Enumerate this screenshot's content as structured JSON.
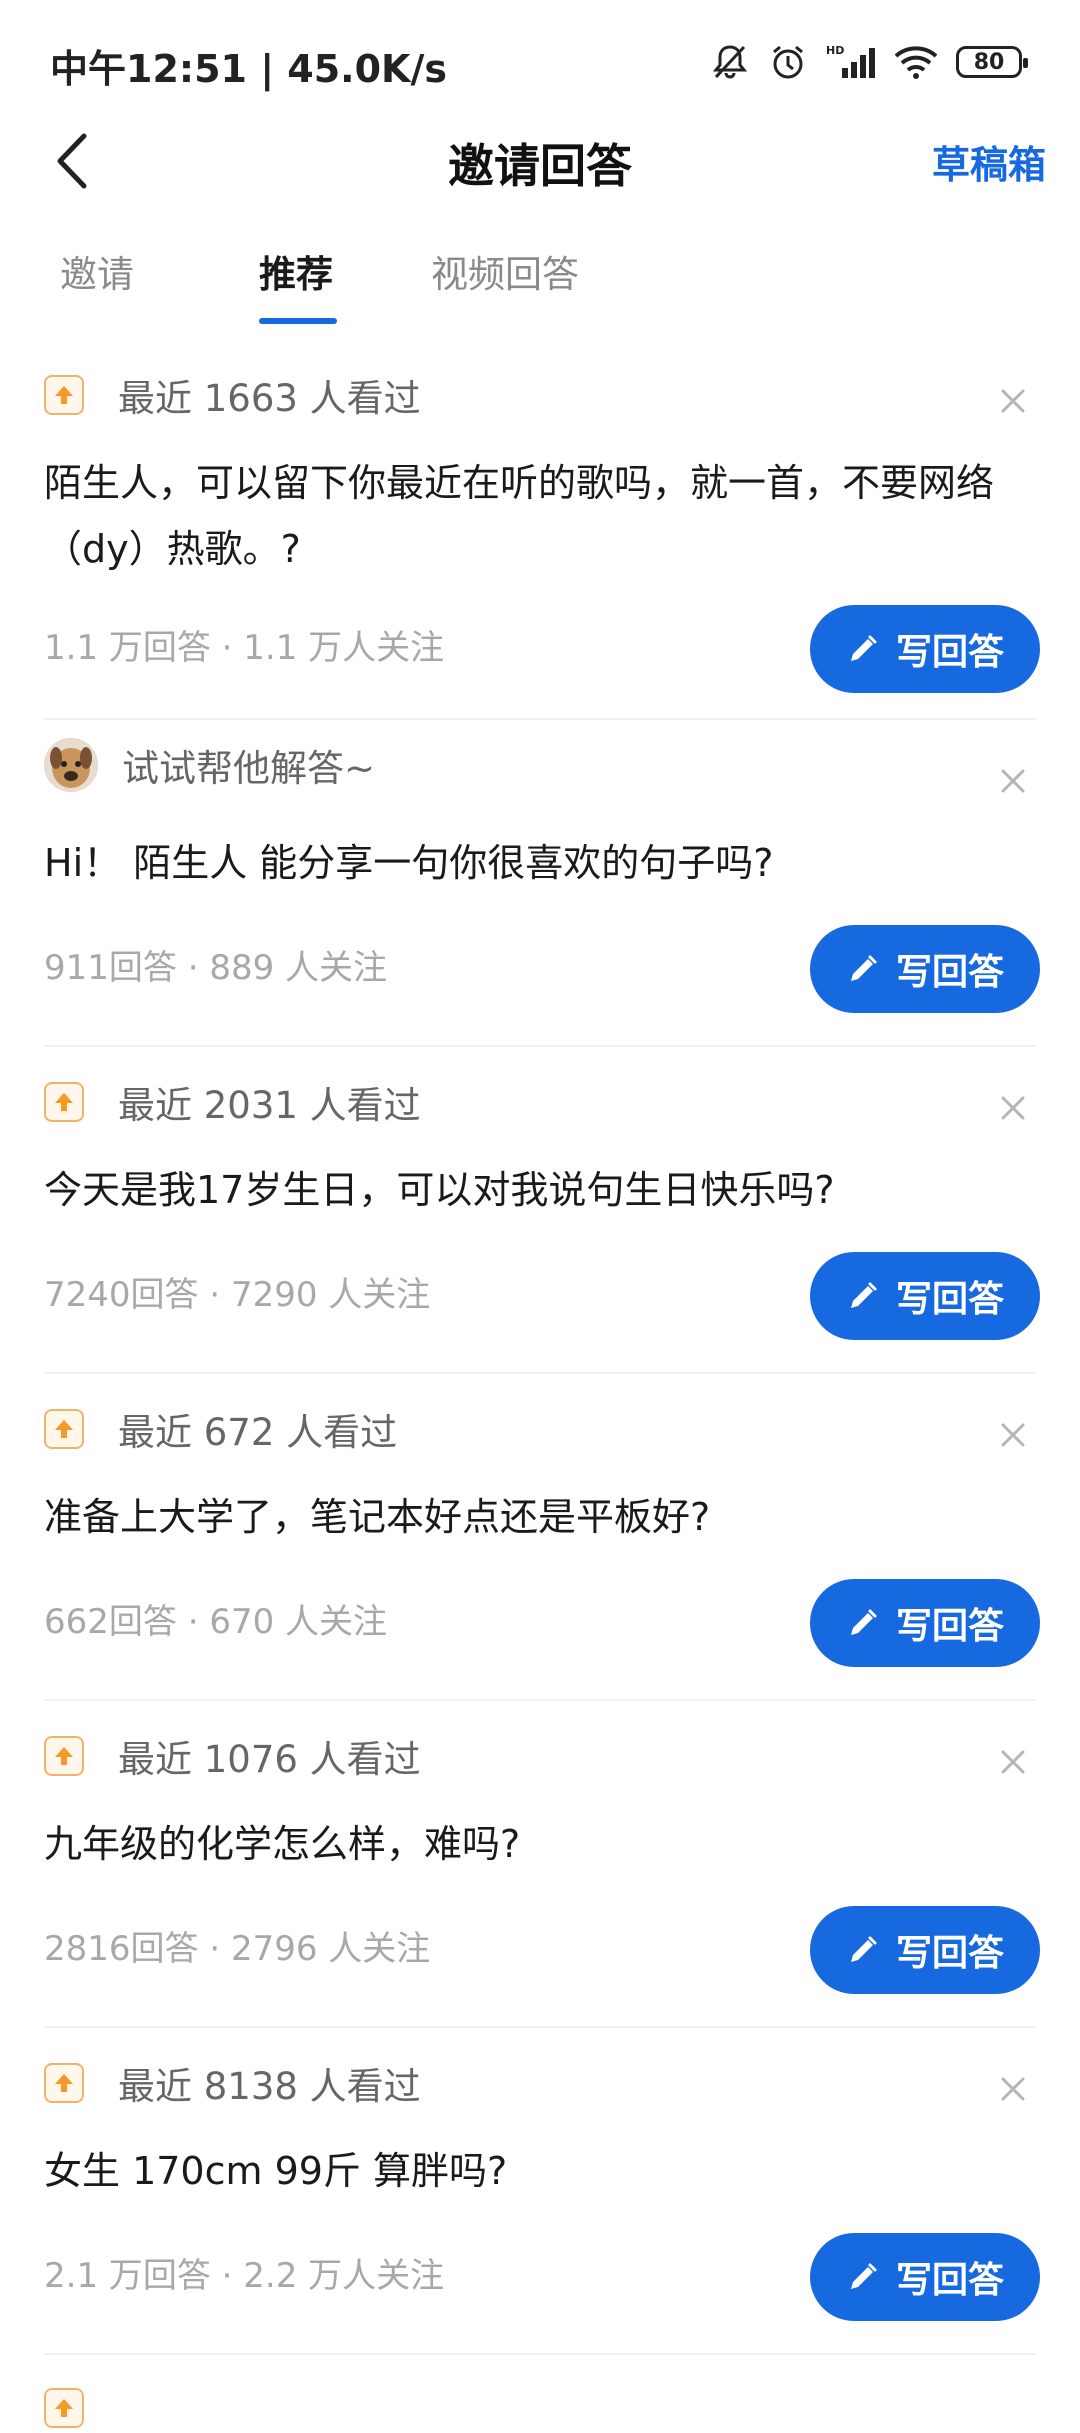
{
  "status_bar": {
    "text": "中午12:51 | 45.0K/s",
    "battery": "80",
    "icons": [
      "bell-muted-icon",
      "alarm-icon",
      "hd-signal-icon",
      "wifi-icon",
      "battery-icon"
    ]
  },
  "header": {
    "title": "邀请回答",
    "right_label": "草稿箱",
    "back_icon": "back-arrow-icon"
  },
  "tabs": [
    {
      "label": "邀请",
      "active": false
    },
    {
      "label": "推荐",
      "active": true
    },
    {
      "label": "视频回答",
      "active": false
    }
  ],
  "colors": {
    "accent": "#1769e0",
    "meta_text": "#666666",
    "stats_text": "#a8a8a8",
    "badge_border": "#f0b36a",
    "badge_arrow": "#f59a23"
  },
  "button_label": "写回答",
  "cards": [
    {
      "meta_icon": "trending-up-icon",
      "meta": "最近 1663 人看过",
      "question": "陌生人，可以留下你最近在听的歌吗，就一首，不要网络（dy）热歌。?",
      "stats": "1.1 万回答 · 1.1 万人关注"
    },
    {
      "meta_icon": "avatar-icon",
      "meta": "试试帮他解答~",
      "question": "Hi！ 陌生人 能分享一句你很喜欢的句子吗?",
      "stats": "911回答 · 889 人关注"
    },
    {
      "meta_icon": "trending-up-icon",
      "meta": "最近 2031 人看过",
      "question": "今天是我17岁生日，可以对我说句生日快乐吗?",
      "stats": "7240回答 · 7290 人关注"
    },
    {
      "meta_icon": "trending-up-icon",
      "meta": "最近 672 人看过",
      "question": "准备上大学了，笔记本好点还是平板好?",
      "stats": "662回答 · 670 人关注"
    },
    {
      "meta_icon": "trending-up-icon",
      "meta": "最近 1076 人看过",
      "question": "九年级的化学怎么样，难吗?",
      "stats": "2816回答 · 2796 人关注"
    },
    {
      "meta_icon": "trending-up-icon",
      "meta": "最近 8138 人看过",
      "question": "女生 170cm 99斤 算胖吗?",
      "stats": "2.1 万回答 · 2.2 万人关注"
    }
  ]
}
